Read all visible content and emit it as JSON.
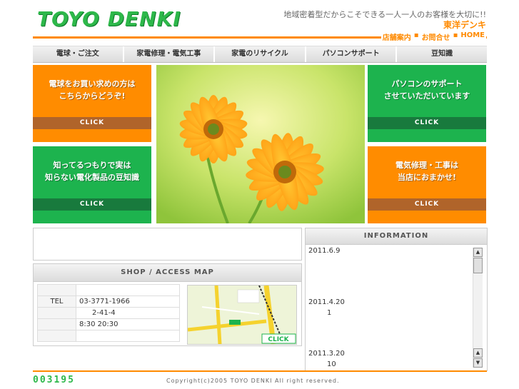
{
  "header": {
    "logo": "TOYO DENKI",
    "tagline": "地域密着型だからこそできる一人一人のお客様を大切に!!",
    "brand": "東洋デンキ",
    "links": [
      "店舗案内",
      "お問合せ",
      "HOME"
    ]
  },
  "nav": [
    "電球・ご注文",
    "家電修理・電気工事",
    "家電のリサイクル",
    "パソコンサポート",
    "豆知識"
  ],
  "panels": {
    "top_left": {
      "line1": "電球をお買い求めの方は",
      "line2": "こちらからどうぞ!",
      "click": "CLICK"
    },
    "bottom_left": {
      "line1": "知ってるつもりで実は",
      "line2": "知らない電化製品の豆知識",
      "click": "CLICK"
    },
    "top_right": {
      "line1": "パソコンのサポート",
      "line2": "させていただいています",
      "click": "CLICK"
    },
    "bottom_right": {
      "line1": "電気修理・工事は",
      "line2": "当店におまかせ!",
      "click": "CLICK"
    }
  },
  "shop": {
    "title": "SHOP / ACCESS MAP",
    "rows": [
      {
        "key": "",
        "value": ""
      },
      {
        "key": "TEL",
        "value": "03-3771-1966"
      },
      {
        "key": "",
        "value": "2-41-4"
      },
      {
        "key": "",
        "value": "8:30 20:30"
      },
      {
        "key": "",
        "value": ""
      }
    ],
    "map_click": "CLICK"
  },
  "information": {
    "title": "INFORMATION",
    "items": [
      {
        "date": "2011.6.9",
        "text": ""
      },
      {
        "date": "2011.4.20",
        "text": "1"
      },
      {
        "date": "2011.3.20",
        "text": "10"
      }
    ]
  },
  "footer": {
    "counter": "003195",
    "copyright": "Copyright(c)2005 TOYO DENKI All right reserved."
  },
  "colors": {
    "orange": "#ff8c00",
    "green": "#1db34e",
    "logo_green": "#2db84a"
  }
}
